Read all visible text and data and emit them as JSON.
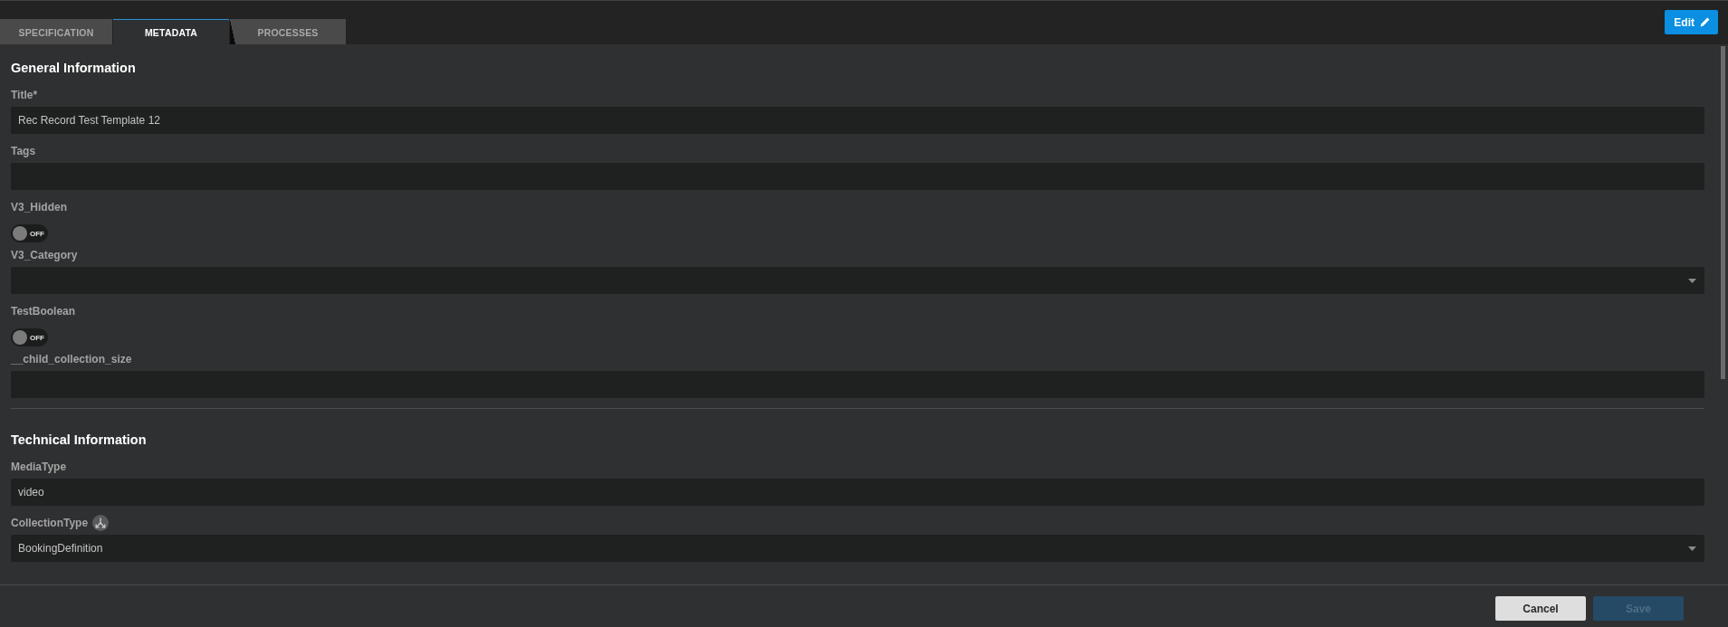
{
  "tabs": [
    {
      "label": "SPECIFICATION",
      "selected": false
    },
    {
      "label": "METADATA",
      "selected": true
    },
    {
      "label": "PROCESSES",
      "selected": false
    }
  ],
  "edit_button": {
    "label": "Edit"
  },
  "sections": [
    {
      "title": "General Information",
      "fields": [
        {
          "kind": "text",
          "label": "Title*",
          "value": "Rec Record Test Template 12"
        },
        {
          "kind": "text",
          "label": "Tags"
        },
        {
          "kind": "toggle",
          "label": "V3_Hidden",
          "on": false,
          "state_text": "OFF"
        },
        {
          "kind": "select",
          "label": "V3_Category"
        },
        {
          "kind": "toggle",
          "label": "TestBoolean",
          "on": false,
          "state_text": "OFF"
        },
        {
          "kind": "text",
          "label": "__child_collection_size"
        }
      ]
    },
    {
      "title": "Technical Information",
      "fields": [
        {
          "kind": "text",
          "label": "MediaType",
          "value": "video"
        },
        {
          "kind": "select",
          "label": "CollectionType",
          "has_icon": true,
          "value": "BookingDefinition"
        }
      ]
    }
  ],
  "footer": {
    "buttons": [
      {
        "label": "Cancel",
        "kind": "secondary",
        "disabled": false
      },
      {
        "label": "Save",
        "kind": "primary",
        "disabled": true
      }
    ]
  }
}
